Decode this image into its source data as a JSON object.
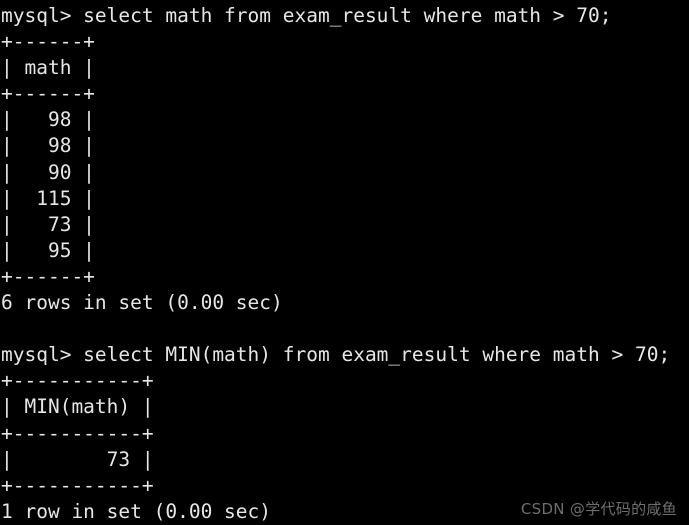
{
  "terminal": {
    "prompt": "mysql>",
    "background_color": "#000000",
    "text_color": "#e6e6e6",
    "blocks": [
      {
        "command_line": "mysql> select math from exam_result where math > 70;",
        "command": "select math from exam_result where math > 70;",
        "table": {
          "separator": "+------+",
          "header_row": "| math |",
          "columns": [
            "math"
          ],
          "rows": [
            "|   98 |",
            "|   98 |",
            "|   90 |",
            "|  115 |",
            "|   73 |",
            "|   95 |"
          ],
          "values": [
            98,
            98,
            90,
            115,
            73,
            95
          ]
        },
        "status": "6 rows in set (0.00 sec)"
      },
      {
        "command_line": "mysql> select MIN(math) from exam_result where math > 70;",
        "command": "select MIN(math) from exam_result where math > 70;",
        "table": {
          "separator": "+-----------+",
          "header_row": "| MIN(math) |",
          "columns": [
            "MIN(math)"
          ],
          "rows": [
            "|        73 |"
          ],
          "values": [
            73
          ]
        },
        "status": "1 row in set (0.00 sec)"
      }
    ],
    "lines": [
      "mysql> select math from exam_result where math > 70;",
      "+------+",
      "| math |",
      "+------+",
      "|   98 |",
      "|   98 |",
      "|   90 |",
      "|  115 |",
      "|   73 |",
      "|   95 |",
      "+------+",
      "6 rows in set (0.00 sec)",
      "",
      "mysql> select MIN(math) from exam_result where math > 70;",
      "+-----------+",
      "| MIN(math) |",
      "+-----------+",
      "|        73 |",
      "+-----------+",
      "1 row in set (0.00 sec)"
    ]
  },
  "watermark": {
    "text": "CSDN @学代码的咸鱼",
    "color": "#6e6e6e"
  }
}
